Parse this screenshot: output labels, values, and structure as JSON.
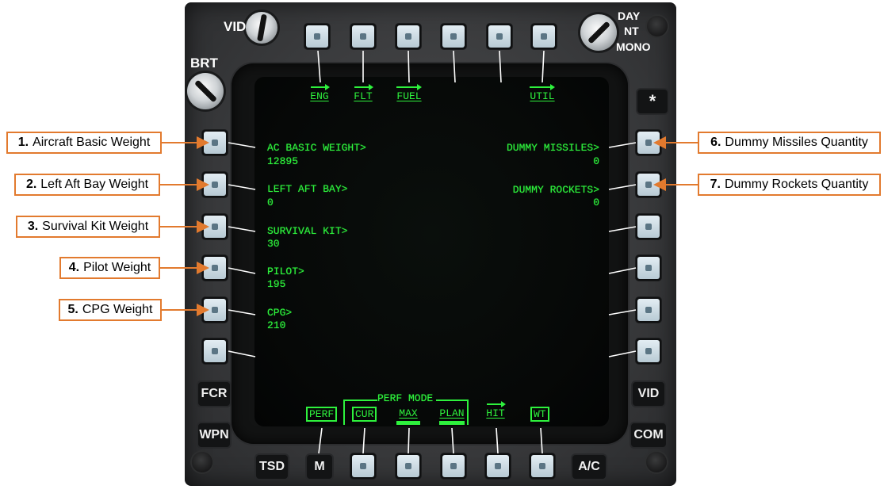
{
  "top_labels": [
    "ENG",
    "FLT",
    "FUEL",
    "UTIL"
  ],
  "left_fields": [
    {
      "label": "AC BASIC WEIGHT>",
      "value": "12895"
    },
    {
      "label": "LEFT AFT BAY>",
      "value": "0"
    },
    {
      "label": "SURVIVAL KIT>",
      "value": "30"
    },
    {
      "label": "PILOT>",
      "value": "195"
    },
    {
      "label": "CPG>",
      "value": "210"
    }
  ],
  "right_fields": [
    {
      "label": "DUMMY MISSILES>",
      "value": "0"
    },
    {
      "label": "DUMMY ROCKETS>",
      "value": "0"
    }
  ],
  "bottom": {
    "perf_mode_header": "PERF MODE",
    "perf": "PERF",
    "cur": "CUR",
    "max": "MAX",
    "plan": "PLAN",
    "hit": "HIT",
    "wt": "WT"
  },
  "bezel": {
    "vid_knob": "VID",
    "brt_knob": "BRT",
    "day": "DAY",
    "nt": "NT",
    "mono": "MONO",
    "asterisk": "*",
    "fcr": "FCR",
    "wpn": "WPN",
    "vid": "VID",
    "com": "COM",
    "tsd": "TSD",
    "m": "M",
    "ac": "A/C"
  },
  "callouts": [
    {
      "num": "1.",
      "text": "Aircraft Basic Weight"
    },
    {
      "num": "2.",
      "text": "Left Aft Bay Weight"
    },
    {
      "num": "3.",
      "text": "Survival Kit Weight"
    },
    {
      "num": "4.",
      "text": "Pilot Weight"
    },
    {
      "num": "5.",
      "text": "CPG Weight"
    },
    {
      "num": "6.",
      "text": "Dummy Missiles Quantity"
    },
    {
      "num": "7.",
      "text": "Dummy Rockets Quantity"
    }
  ],
  "colors": {
    "display_green": "#2ef23d",
    "callout_border": "#e27a2e",
    "bezel": "#3a3b3d"
  }
}
